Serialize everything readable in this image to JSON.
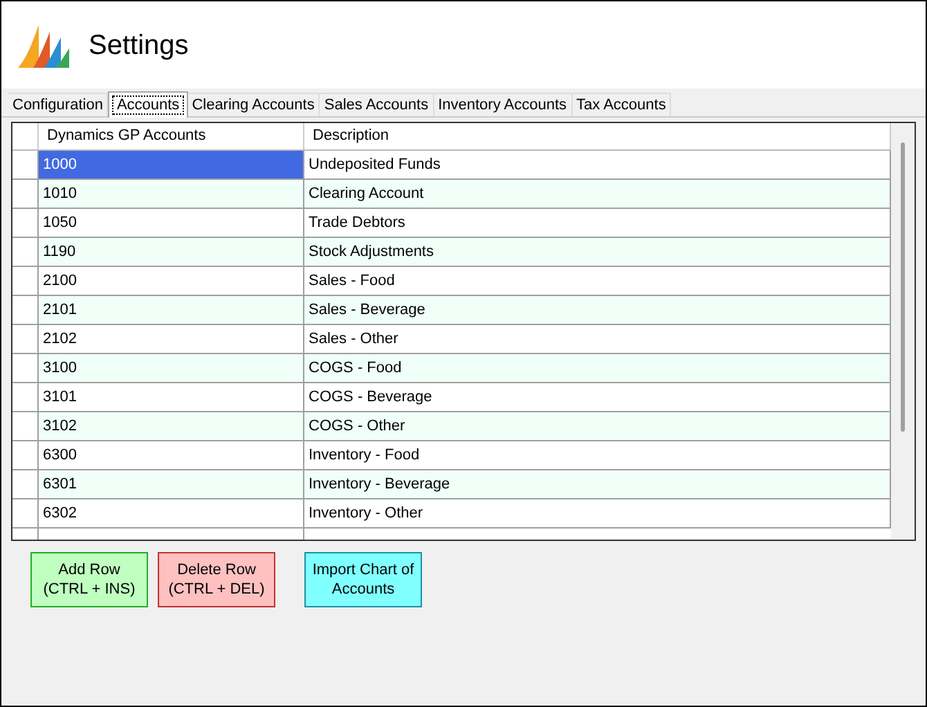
{
  "window": {
    "title": "Settings"
  },
  "tabs": [
    {
      "label": "Configuration",
      "selected": false
    },
    {
      "label": "Accounts",
      "selected": true
    },
    {
      "label": "Clearing Accounts",
      "selected": false
    },
    {
      "label": "Sales Accounts",
      "selected": false
    },
    {
      "label": "Inventory Accounts",
      "selected": false
    },
    {
      "label": "Tax Accounts",
      "selected": false
    }
  ],
  "table": {
    "columns": [
      "Dynamics GP Accounts",
      "Description"
    ],
    "rows": [
      {
        "account": "1000",
        "description": "Undeposited Funds",
        "selected": true
      },
      {
        "account": "1010",
        "description": "Clearing Account",
        "selected": false
      },
      {
        "account": "1050",
        "description": "Trade Debtors",
        "selected": false
      },
      {
        "account": "1190",
        "description": "Stock Adjustments",
        "selected": false
      },
      {
        "account": "2100",
        "description": "Sales - Food",
        "selected": false
      },
      {
        "account": "2101",
        "description": "Sales - Beverage",
        "selected": false
      },
      {
        "account": "2102",
        "description": "Sales - Other",
        "selected": false
      },
      {
        "account": "3100",
        "description": "COGS - Food",
        "selected": false
      },
      {
        "account": "3101",
        "description": "COGS - Beverage",
        "selected": false
      },
      {
        "account": "3102",
        "description": "COGS - Other",
        "selected": false
      },
      {
        "account": "6300",
        "description": "Inventory - Food",
        "selected": false
      },
      {
        "account": "6301",
        "description": "Inventory - Beverage",
        "selected": false
      },
      {
        "account": "6302",
        "description": "Inventory - Other",
        "selected": false
      }
    ]
  },
  "buttons": [
    {
      "kind": "add",
      "lines": [
        "Add Row",
        "(CTRL + INS)"
      ]
    },
    {
      "kind": "delete",
      "lines": [
        "Delete Row",
        "(CTRL + DEL)"
      ]
    },
    {
      "kind": "import",
      "lines": [
        "Import Chart of",
        "Accounts"
      ]
    }
  ]
}
